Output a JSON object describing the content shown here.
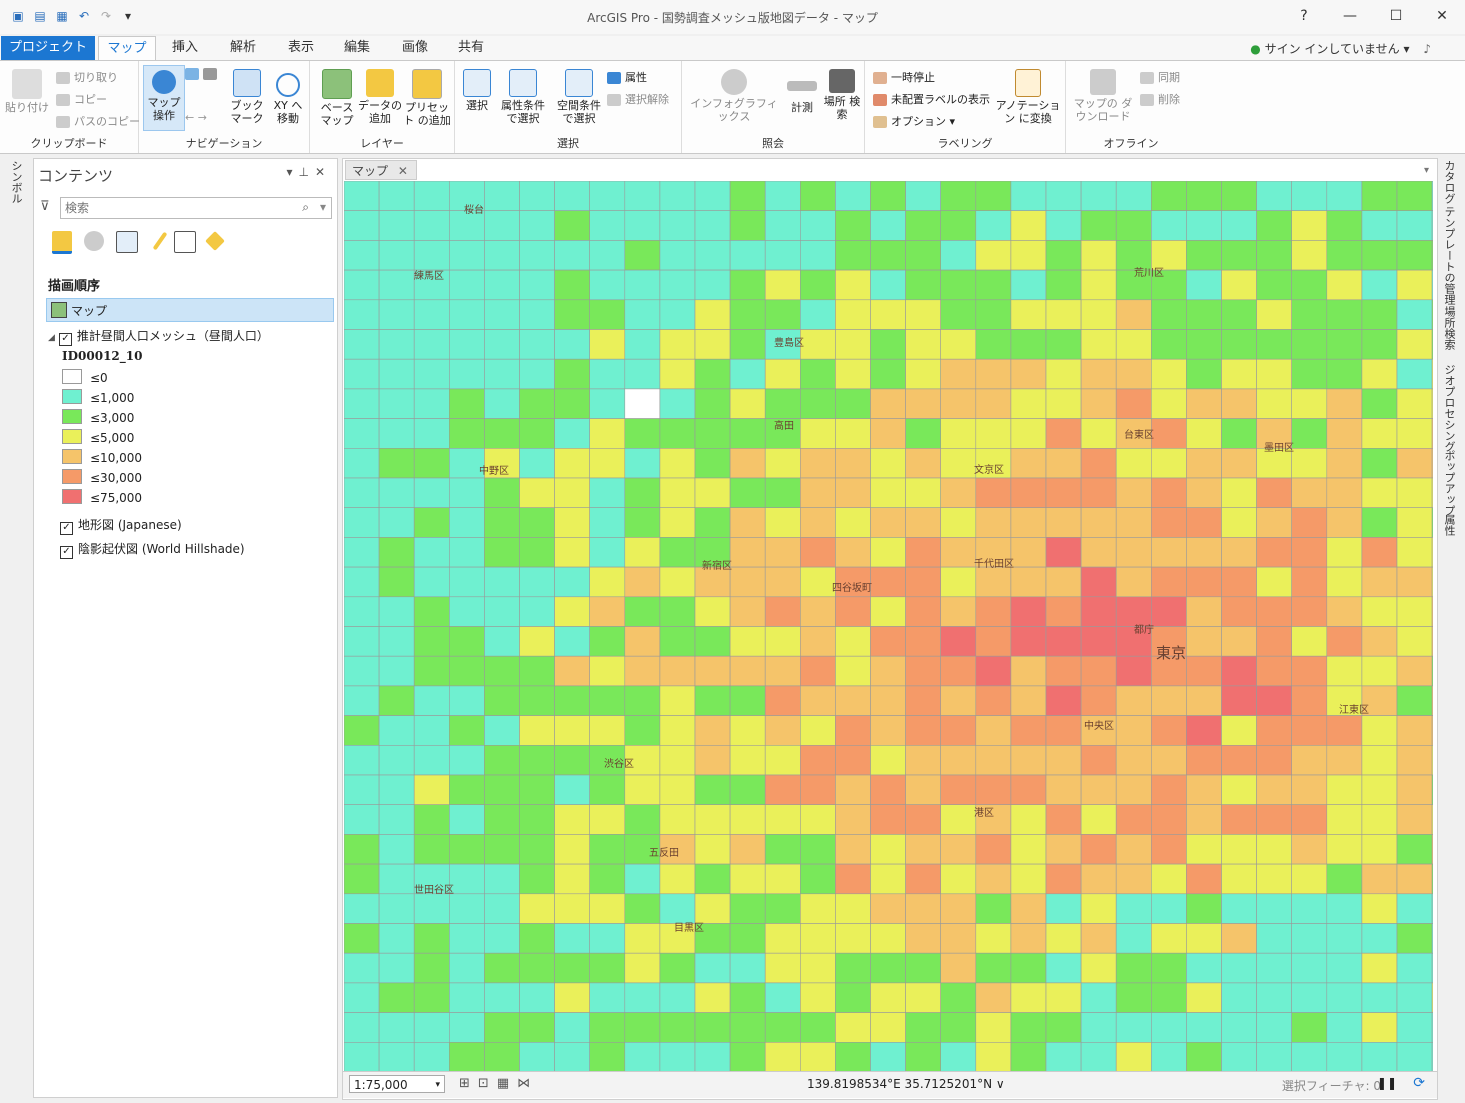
{
  "window": {
    "title": "ArcGIS Pro - 国勢調査メッシュ版地図データ - マップ",
    "help": "?",
    "minimize": "—",
    "maximize": "☐",
    "close": "✕"
  },
  "quick_access": {
    "icons": [
      "new-project-icon",
      "open-icon",
      "save-icon",
      "undo-icon",
      "redo-icon",
      "customize-icon"
    ]
  },
  "tabs": {
    "project": "プロジェクト",
    "items": [
      "マップ",
      "挿入",
      "解析",
      "表示",
      "編集",
      "画像",
      "共有"
    ],
    "active": "マップ"
  },
  "account": {
    "signin": "サイン インしていません"
  },
  "ribbon": {
    "clipboard": {
      "label": "クリップボード",
      "paste": "貼り付け",
      "cut": "切り取り",
      "copy": "コピー",
      "copy_path": "パスのコピー"
    },
    "navigation": {
      "label": "ナビゲーション",
      "explore": "マップ 操作",
      "bookmarks": "ブック マーク",
      "goto_xy": "XY へ移動"
    },
    "layer": {
      "label": "レイヤー",
      "basemap": "ベース マップ",
      "add_data": "データの 追加",
      "add_preset": "プリセット の追加"
    },
    "selection": {
      "label": "選択",
      "select": "選択",
      "by_attributes": "属性条件 で選択",
      "by_location": "空間条件 で選択",
      "attributes": "属性",
      "clear": "選択解除"
    },
    "inquiry": {
      "label": "照会",
      "infographics": "インフォグラフィックス",
      "measure": "計測",
      "locate": "場所 検索"
    },
    "labeling": {
      "label": "ラベリング",
      "pause": "一時停止",
      "unplaced": "未配置ラベルの表示",
      "options": "オプション",
      "convert": "アノテーション に変換"
    },
    "offline": {
      "label": "オフライン",
      "download_map": "マップの ダウンロード",
      "sync": "同期",
      "remove": "削除"
    }
  },
  "left_strip": {
    "symbology": "シンボル"
  },
  "contents": {
    "title": "コンテンツ",
    "search_placeholder": "検索",
    "drawing_order": "描画順序",
    "map_item": "マップ",
    "layer_name": "推計昼間人口メッシュ（昼間人口）",
    "field": "ID00012_10",
    "legend": [
      {
        "label": "≤0",
        "color": "#ffffff"
      },
      {
        "label": "≤1,000",
        "color": "#6ff0d0"
      },
      {
        "label": "≤3,000",
        "color": "#79e85a"
      },
      {
        "label": "≤5,000",
        "color": "#eaf05a"
      },
      {
        "label": "≤10,000",
        "color": "#f5c46a"
      },
      {
        "label": "≤30,000",
        "color": "#f59a68"
      },
      {
        "label": "≤75,000",
        "color": "#f07070"
      }
    ],
    "basemap1": "地形図 (Japanese)",
    "basemap2": "陰影起伏図 (World Hillshade)"
  },
  "map": {
    "tab": "マップ",
    "labels": [
      "桜台",
      "練馬区",
      "豊島区",
      "荒川区",
      "高田",
      "文京区",
      "台東区",
      "墨田区",
      "中野区",
      "新宿区",
      "千代田区",
      "四谷坂町",
      "東京",
      "中央区",
      "江東区",
      "渋谷区",
      "港区",
      "世田谷区",
      "目黒区",
      "都庁",
      "五反田"
    ],
    "scale": "1:75,000",
    "coords": "139.8198534°E 35.7125201°N",
    "selected_features": "選択フィーチャ: 0"
  },
  "right_strip": [
    "カタログ",
    "テンプレートの管理",
    "場所検索",
    "ジオプロセシング",
    "ポップアップ",
    "属性"
  ]
}
